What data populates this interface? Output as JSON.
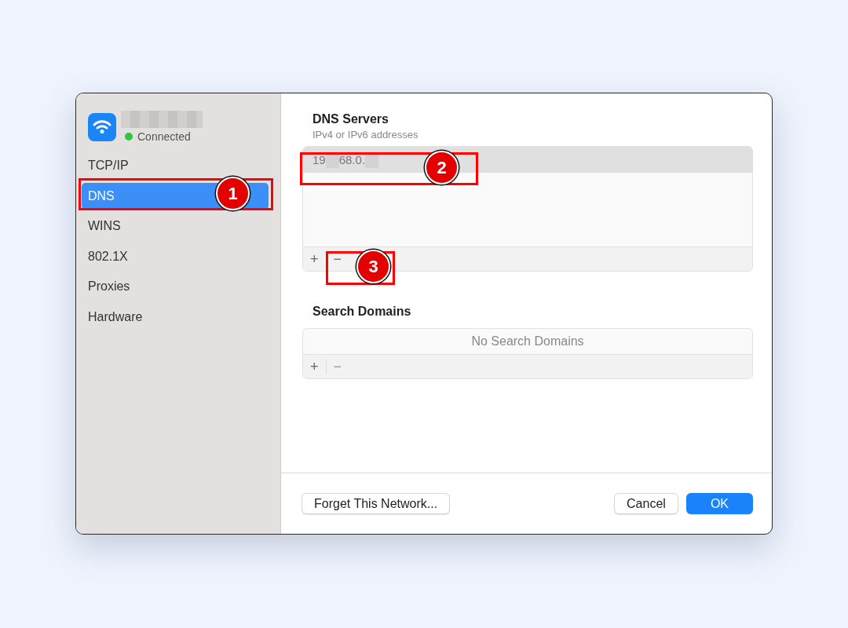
{
  "network": {
    "status": "Connected"
  },
  "sidebar": {
    "items": [
      {
        "label": "TCP/IP",
        "selected": false
      },
      {
        "label": "DNS",
        "selected": true
      },
      {
        "label": "WINS",
        "selected": false
      },
      {
        "label": "802.1X",
        "selected": false
      },
      {
        "label": "Proxies",
        "selected": false
      },
      {
        "label": "Hardware",
        "selected": false
      }
    ]
  },
  "dns_servers": {
    "title": "DNS Servers",
    "subtitle": "IPv4 or IPv6 addresses",
    "entries": [
      {
        "parts": [
          "19",
          "68.0."
        ],
        "selected": true
      }
    ],
    "add": {
      "label": "+",
      "disabled": false
    },
    "remove": {
      "label": "−",
      "disabled": false
    }
  },
  "search_domains": {
    "title": "Search Domains",
    "empty_text": "No Search Domains",
    "add": {
      "label": "+",
      "disabled": false
    },
    "remove": {
      "label": "−",
      "disabled": true
    }
  },
  "buttons": [
    {
      "label": "Forget This Network...",
      "kind": "secondary"
    },
    {
      "label": "Cancel",
      "kind": "secondary"
    },
    {
      "label": "OK",
      "kind": "primary"
    }
  ],
  "callouts": [
    {
      "number": "1"
    },
    {
      "number": "2"
    },
    {
      "number": "3"
    }
  ]
}
